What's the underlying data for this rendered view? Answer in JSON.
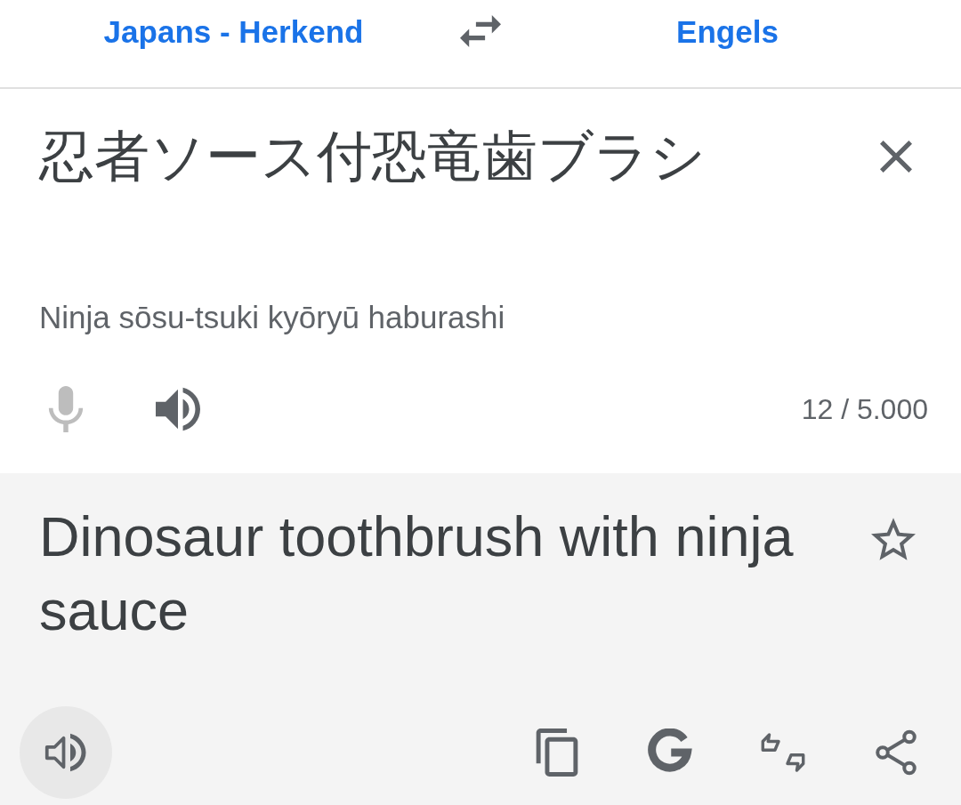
{
  "language_bar": {
    "source_language": "Japans - Herkend",
    "target_language": "Engels"
  },
  "input": {
    "value": "忍者ソース付恐竜歯ブラシ",
    "romanization": "Ninja sōsu-tsuki kyōryū haburashi",
    "char_count": "12 / 5.000",
    "mic_disabled": true
  },
  "output": {
    "text": "Dinosaur toothbrush with ninja sauce",
    "starred": false
  }
}
